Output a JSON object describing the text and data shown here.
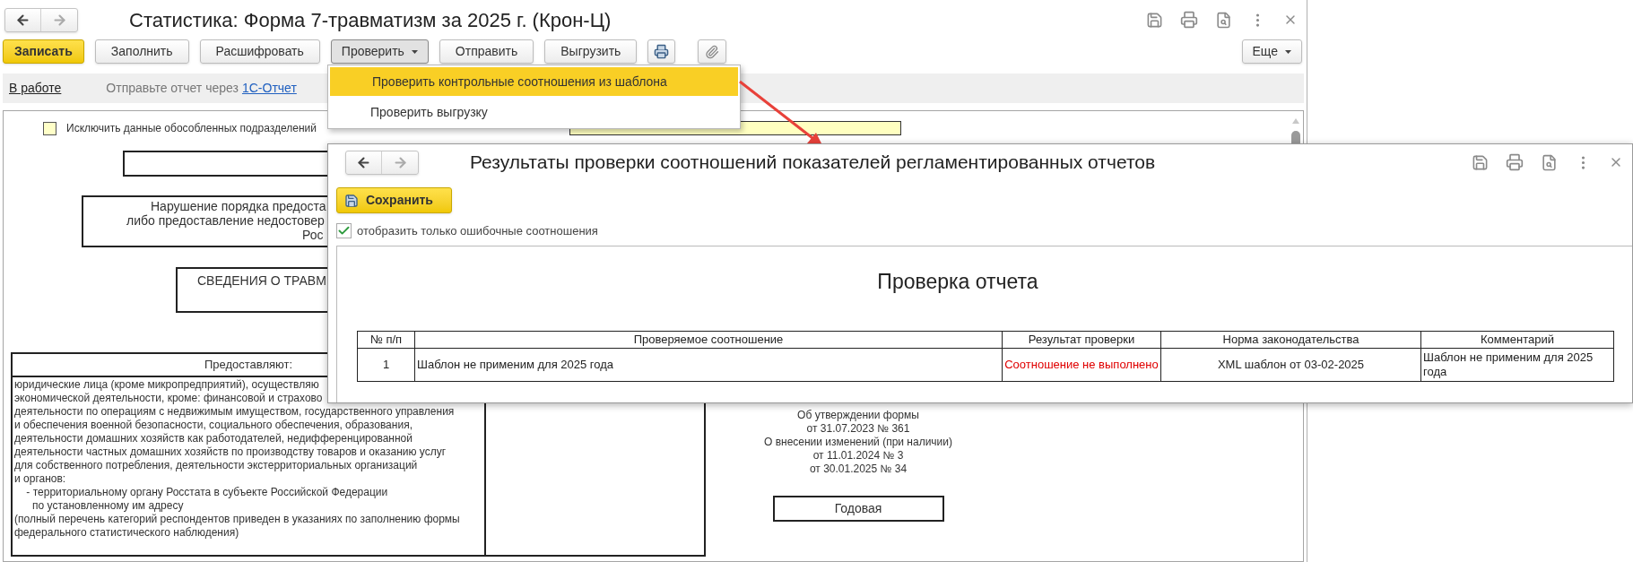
{
  "window": {
    "title": "Статистика: Форма 7-травматизм за 2025 г. (Крон-Ц)"
  },
  "toolbar": {
    "buttons": [
      {
        "kind": "primary",
        "label": "Записать",
        "pressed": false
      },
      {
        "kind": "text",
        "label": "Заполнить",
        "pressed": false
      },
      {
        "kind": "text",
        "label": "Расшифровать",
        "pressed": false
      },
      {
        "kind": "menu",
        "label": "Проверить",
        "pressed": true
      },
      {
        "kind": "text",
        "label": "Отправить",
        "pressed": false
      },
      {
        "kind": "text",
        "label": "Выгрузить",
        "pressed": false
      },
      {
        "kind": "print",
        "pressed": false
      },
      {
        "kind": "attach",
        "pressed": false
      }
    ],
    "more": "Еще"
  },
  "status_bar": {
    "status": "В работе",
    "hint": "Отправьте отчет через",
    "link": "1С-Отчет"
  },
  "dropdown": {
    "items": [
      {
        "label": "Проверить контрольные соотношения из шаблона",
        "selected": true
      },
      {
        "label": "Проверить выгрузку",
        "selected": false
      }
    ]
  },
  "document": {
    "exclude": {
      "label": "Исключить данные обособленных подразделений",
      "checked": false
    },
    "violation_lines": [
      "Нарушение порядка предоста",
      "либо предоставление недостовер",
      "Рос"
    ],
    "info_title": "СВЕДЕНИЯ О ТРАВМ",
    "provide_header": "Предоставляют:",
    "provide_lines": [
      "юридические лица (кроме микропредприятий), осуществляю",
      "экономической деятельности, кроме: финансовой и страхово",
      "деятельности по операциям с недвижимым имуществом, государственного управления",
      "и обеспечения военной безопасности, социального обеспечения, образования,",
      "деятельности домашних хозяйств как работодателей, недифференцированной",
      "деятельности частных домашних хозяйств по производству товаров и оказанию услуг",
      "для собственного потребления, деятельности экстерриториальных организаций",
      "и органов:",
      "    - территориальному органу Росстата в субъекте Российской Федерации",
      "      по установленному им адресу",
      "(полный перечень категорий респондентов приведен в указаниях по заполнению формы",
      "федерального статистического наблюдения)"
    ],
    "order_lines": [
      "Об утверждении формы",
      "от 31.07.2023 № 361",
      "О внесении изменений (при наличии)",
      "от 11.01.2024 № 3",
      "от 30.01.2025 № 34"
    ],
    "period": "Годовая"
  },
  "dialog": {
    "title": "Результаты проверки соотношений показателей регламентированных отчетов",
    "save_button": "Сохранить",
    "filter": {
      "label": "отобразить только ошибочные соотношения",
      "checked": true
    },
    "report_title": "Проверка отчета",
    "table": {
      "columns": [
        "№ п/п",
        "Проверяемое соотношение",
        "Результат проверки",
        "Норма законодательства",
        "Комментарий"
      ],
      "rows": [
        {
          "cells": [
            "1",
            "Шаблон не применим для 2025 года",
            "Соотношение не выполнено",
            "XML шаблон от 03-02-2025",
            "Шаблон не применим для 2025 года"
          ],
          "passed": false
        }
      ]
    }
  }
}
